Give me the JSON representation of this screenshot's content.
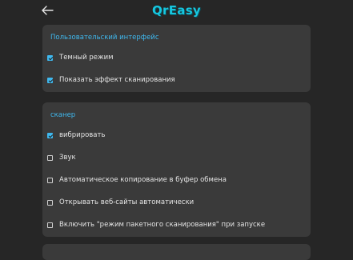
{
  "header": {
    "back_icon": "arrow-left-icon",
    "app_name": "QrEasy"
  },
  "sections": [
    {
      "title": "Пользовательский интерфейс",
      "options": [
        {
          "label": "Темный режим",
          "checked": true
        },
        {
          "label": "Показать эффект сканирования",
          "checked": true
        }
      ]
    },
    {
      "title": "сканер",
      "options": [
        {
          "label": "вибрировать",
          "checked": true
        },
        {
          "label": "Звук",
          "checked": false
        },
        {
          "label": "Автоматическое копирование в буфер обмена",
          "checked": false
        },
        {
          "label": "Открывать веб-сайты автоматически",
          "checked": false
        },
        {
          "label": "Включить \"режим пакетного сканирования\" при запуске",
          "checked": false
        }
      ]
    }
  ],
  "colors": {
    "background": "#262626",
    "card": "#3a3a3a",
    "accent": "#3fb8ee",
    "logo": "#16c7e0",
    "text": "#e4e4e4"
  }
}
